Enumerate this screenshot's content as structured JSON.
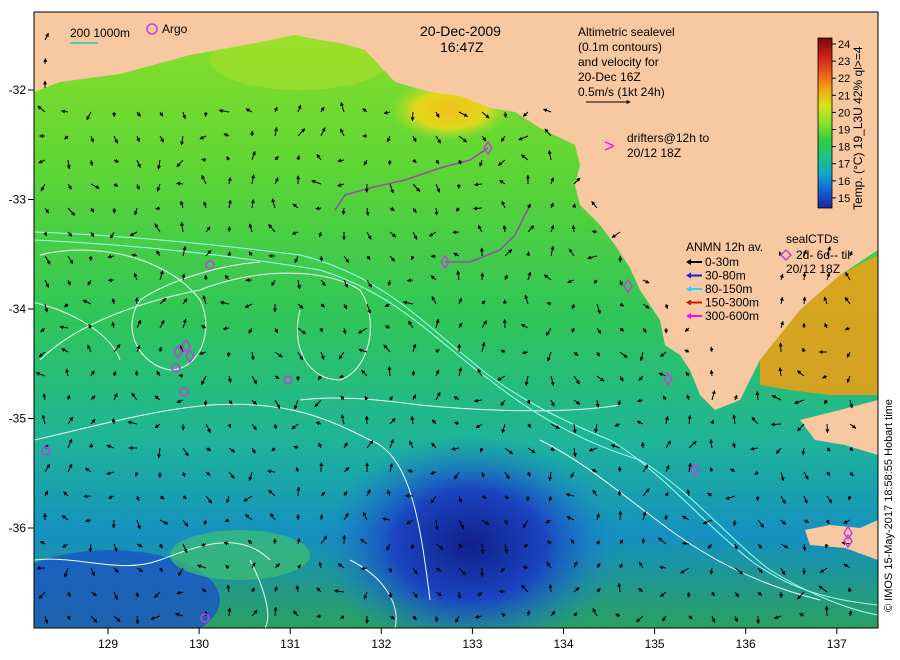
{
  "title": {
    "date": "20-Dec-2009",
    "time": "16:47Z"
  },
  "legend_topleft": {
    "isobath_label": "200  1000m",
    "argo_label": "Argo"
  },
  "altimetry_note": [
    "Altimetric sealevel",
    "(0.1m contours)",
    "and velocity for",
    "20-Dec 16Z",
    "0.5m/s (1kt 24h)"
  ],
  "drifters_note": {
    "symbol": ">",
    "lines": [
      "drifters@12h to",
      "20/12 18Z"
    ]
  },
  "anmn_legend": {
    "title": "ANMN 12h av.",
    "items": [
      {
        "label": "0-30m",
        "color": "#000000"
      },
      {
        "label": "30-80m",
        "color": "#1020e0"
      },
      {
        "label": "80-150m",
        "color": "#20d8ff"
      },
      {
        "label": "150-300m",
        "color": "#d01010"
      },
      {
        "label": "300-600m",
        "color": "#ff00ff"
      }
    ]
  },
  "seal_legend": {
    "title": "sealCTDs",
    "line1": "2d- 6d-- til",
    "line2": "20/12 18Z"
  },
  "colorbar": {
    "label": "Temp. (°C) 19_L3U 42% ql>=4",
    "ticks": [
      "24",
      "23",
      "22",
      "21",
      "20",
      "19",
      "18",
      "17",
      "16",
      "15"
    ],
    "colors": [
      "#7a0a0a",
      "#c62015",
      "#e8561a",
      "#f2a515",
      "#d6e41a",
      "#8ae32a",
      "#33cc3a",
      "#1fc08a",
      "#10a8c8",
      "#1560d8",
      "#1a2a9a"
    ]
  },
  "x_axis_ticks": [
    "129",
    "130",
    "131",
    "132",
    "133",
    "134",
    "135",
    "136",
    "137"
  ],
  "y_axis_ticks": [
    "-32",
    "-33",
    "-34",
    "-35",
    "-36"
  ],
  "credit": "© IMOS 15-May-2017 18:58:55 Hobart time",
  "colors": {
    "land": "#f8c9a0",
    "argo": "#c040e0",
    "contour": "#e8fff4",
    "isobath200": "#9ffff0"
  }
}
